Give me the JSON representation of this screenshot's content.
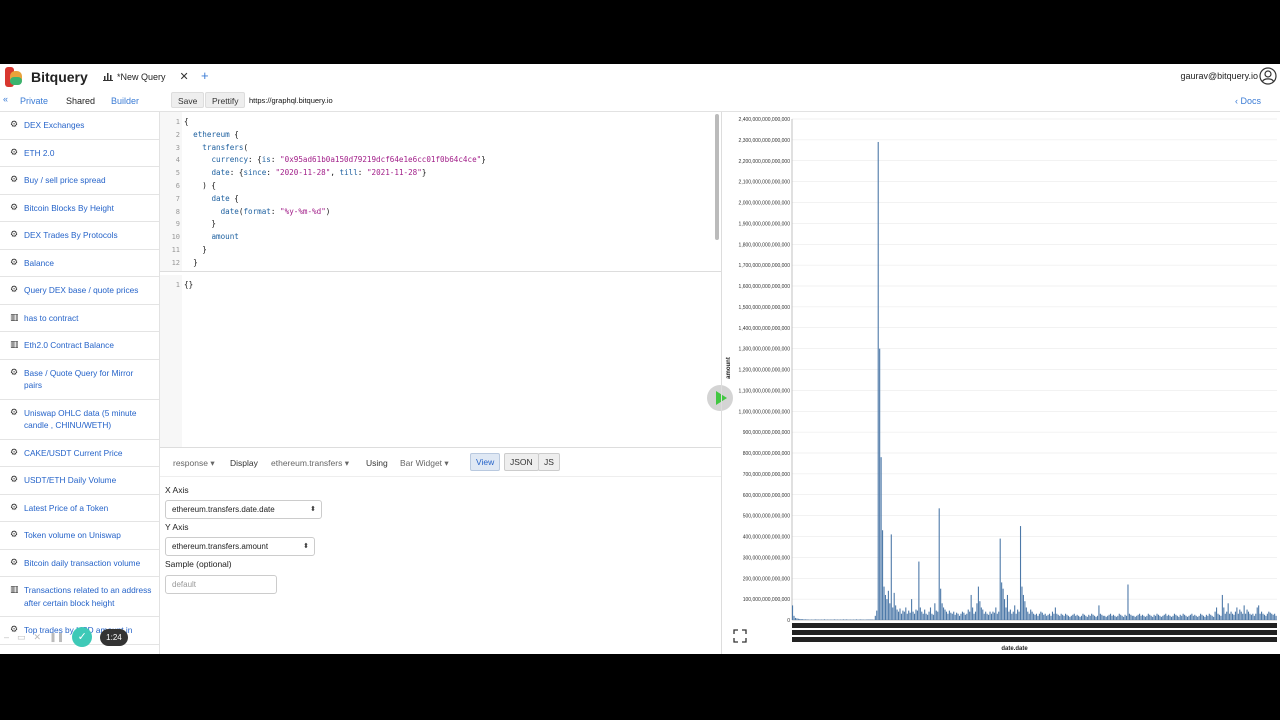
{
  "app": {
    "brand": "Bitquery",
    "user_email": "gaurav@bitquery.io"
  },
  "tab": {
    "title": "*New Query"
  },
  "toolbar": {
    "private": "Private",
    "shared": "Shared",
    "builder": "Builder",
    "save": "Save",
    "prettify": "Prettify",
    "endpoint": "https://graphql.bitquery.io",
    "docs": "Docs"
  },
  "sidebar": {
    "items": [
      {
        "label": "DEX Exchanges",
        "icon": "gear-icon"
      },
      {
        "label": "ETH 2.0",
        "icon": "gear-icon"
      },
      {
        "label": "Buy / sell price spread",
        "icon": "gear-icon"
      },
      {
        "label": "Bitcoin Blocks By Height",
        "icon": "gear-icon"
      },
      {
        "label": "DEX Trades By Protocols",
        "icon": "gear-icon"
      },
      {
        "label": "Balance",
        "icon": "gear-icon"
      },
      {
        "label": "Query DEX base / quote prices",
        "icon": "gear-icon"
      },
      {
        "label": "has to contract",
        "icon": "bar-chart-icon"
      },
      {
        "label": "Eth2.0 Contract Balance",
        "icon": "bar-chart-icon"
      },
      {
        "label": "Base / Quote Query for Mirror pairs",
        "icon": "gear-icon"
      },
      {
        "label": "Uniswap OHLC data (5 minute candle , CHINU/WETH)",
        "icon": "gear-icon"
      },
      {
        "label": "CAKE/USDT Current Price",
        "icon": "gear-icon"
      },
      {
        "label": "USDT/ETH Daily Volume",
        "icon": "gear-icon"
      },
      {
        "label": "Latest Price of a Token",
        "icon": "gear-icon"
      },
      {
        "label": "Token volume on Uniswap",
        "icon": "gear-icon"
      },
      {
        "label": "Bitcoin daily transaction volume",
        "icon": "gear-icon"
      },
      {
        "label": "Transactions related to an address after certain block height",
        "icon": "bar-chart-icon"
      },
      {
        "label": "Top trades by USD amount in",
        "icon": "gear-icon"
      }
    ]
  },
  "editor": {
    "line_numbers": "1\n2\n3\n4\n5\n6\n7\n8\n9\n10\n11\n12",
    "lines": [
      "{",
      "  ethereum {",
      "    transfers(",
      "      currency: {is: \"0x95ad61b0a150d79219dcf64e1e6cc01f0b64c4ce\"}",
      "      date: {since: \"2020-11-28\", till: \"2021-11-28\"}",
      "    ) {",
      "      date {",
      "        date(format: \"%y-%m-%d\")",
      "      }",
      "      amount",
      "    }",
      "  }"
    ]
  },
  "result": {
    "line_numbers": "1",
    "text": "{}"
  },
  "widget": {
    "response": "response",
    "display": "Display",
    "path": "ethereum.transfers",
    "using": "Using",
    "widget_type": "Bar Widget",
    "view": "View",
    "json": "JSON",
    "js": "JS",
    "x_axis_label": "X Axis",
    "x_axis_value": "ethereum.transfers.date.date",
    "y_axis_label": "Y Axis",
    "y_axis_value": "ethereum.transfers.amount",
    "sample_label": "Sample (optional)",
    "sample_placeholder": "default"
  },
  "recorder": {
    "time": "1:24"
  },
  "chart_data": {
    "type": "bar",
    "xlabel": "date.date",
    "ylabel": "amount",
    "ylim": [
      0,
      2400000000000000
    ],
    "ytick_step": 100000000000000,
    "y_tick_labels": [
      "0",
      "100,000,000,000,000",
      "200,000,000,000,000",
      "300,000,000,000,000",
      "400,000,000,000,000",
      "500,000,000,000,000",
      "600,000,000,000,000",
      "700,000,000,000,000",
      "800,000,000,000,000",
      "900,000,000,000,000",
      "1,000,000,000,000,000",
      "1,100,000,000,000,000",
      "1,200,000,000,000,000",
      "1,300,000,000,000,000",
      "1,400,000,000,000,000",
      "1,500,000,000,000,000",
      "1,600,000,000,000,000",
      "1,700,000,000,000,000",
      "1,800,000,000,000,000",
      "1,900,000,000,000,000",
      "2,000,000,000,000,000",
      "2,100,000,000,000,000",
      "2,200,000,000,000,000",
      "2,300,000,000,000,000",
      "2,400,000,000,000,000"
    ],
    "values_1e12": [
      70,
      20,
      10,
      8,
      6,
      5,
      4,
      4,
      3,
      3,
      3,
      2,
      2,
      2,
      2,
      2,
      3,
      2,
      2,
      2,
      2,
      2,
      3,
      2,
      2,
      2,
      2,
      2,
      2,
      3,
      2,
      2,
      2,
      2,
      2,
      3,
      2,
      3,
      2,
      2,
      2,
      2,
      2,
      2,
      3,
      2,
      2,
      3,
      2,
      2,
      2,
      2,
      3,
      2,
      3,
      2,
      2,
      20,
      45,
      2290,
      1300,
      780,
      430,
      160,
      120,
      100,
      140,
      80,
      410,
      60,
      130,
      70,
      50,
      40,
      55,
      30,
      45,
      40,
      60,
      30,
      45,
      35,
      100,
      40,
      30,
      50,
      45,
      280,
      60,
      40,
      30,
      50,
      30,
      25,
      40,
      60,
      30,
      25,
      80,
      45,
      40,
      535,
      150,
      80,
      60,
      50,
      40,
      30,
      45,
      35,
      30,
      40,
      25,
      35,
      30,
      20,
      30,
      40,
      35,
      25,
      30,
      50,
      40,
      120,
      60,
      30,
      40,
      80,
      160,
      90,
      60,
      50,
      30,
      40,
      30,
      25,
      40,
      30,
      40,
      35,
      60,
      30,
      40,
      390,
      180,
      150,
      100,
      60,
      120,
      40,
      50,
      30,
      40,
      70,
      30,
      50,
      40,
      450,
      160,
      120,
      90,
      60,
      40,
      30,
      50,
      40,
      30,
      25,
      30,
      20,
      30,
      40,
      35,
      25,
      30,
      20,
      25,
      30,
      20,
      40,
      30,
      60,
      30,
      25,
      20,
      30,
      25,
      20,
      30,
      25,
      20,
      15,
      20,
      25,
      30,
      20,
      25,
      20,
      15,
      20,
      30,
      25,
      20,
      15,
      25,
      20,
      30,
      25,
      20,
      15,
      20,
      70,
      30,
      25,
      20,
      20,
      15,
      20,
      25,
      30,
      20,
      25,
      20,
      15,
      20,
      30,
      25,
      20,
      15,
      25,
      20,
      170,
      30,
      25,
      20,
      20,
      15,
      20,
      25,
      30,
      20,
      25,
      20,
      15,
      20,
      30,
      25,
      20,
      15,
      25,
      20,
      30,
      25,
      20,
      15,
      20,
      25,
      30,
      20,
      25,
      20,
      15,
      20,
      30,
      25,
      20,
      15,
      25,
      20,
      30,
      25,
      20,
      15,
      20,
      25,
      30,
      20,
      25,
      20,
      15,
      20,
      30,
      25,
      20,
      15,
      25,
      20,
      30,
      25,
      20,
      15,
      40,
      60,
      30,
      25,
      20,
      120,
      60,
      30,
      40,
      80,
      30,
      40,
      30,
      25,
      40,
      60,
      30,
      50,
      40,
      30,
      70,
      30,
      50,
      40,
      30,
      25,
      30,
      20,
      30,
      60,
      70,
      30,
      40,
      30,
      25,
      20,
      30,
      40,
      35,
      30,
      25,
      30,
      20
    ]
  }
}
